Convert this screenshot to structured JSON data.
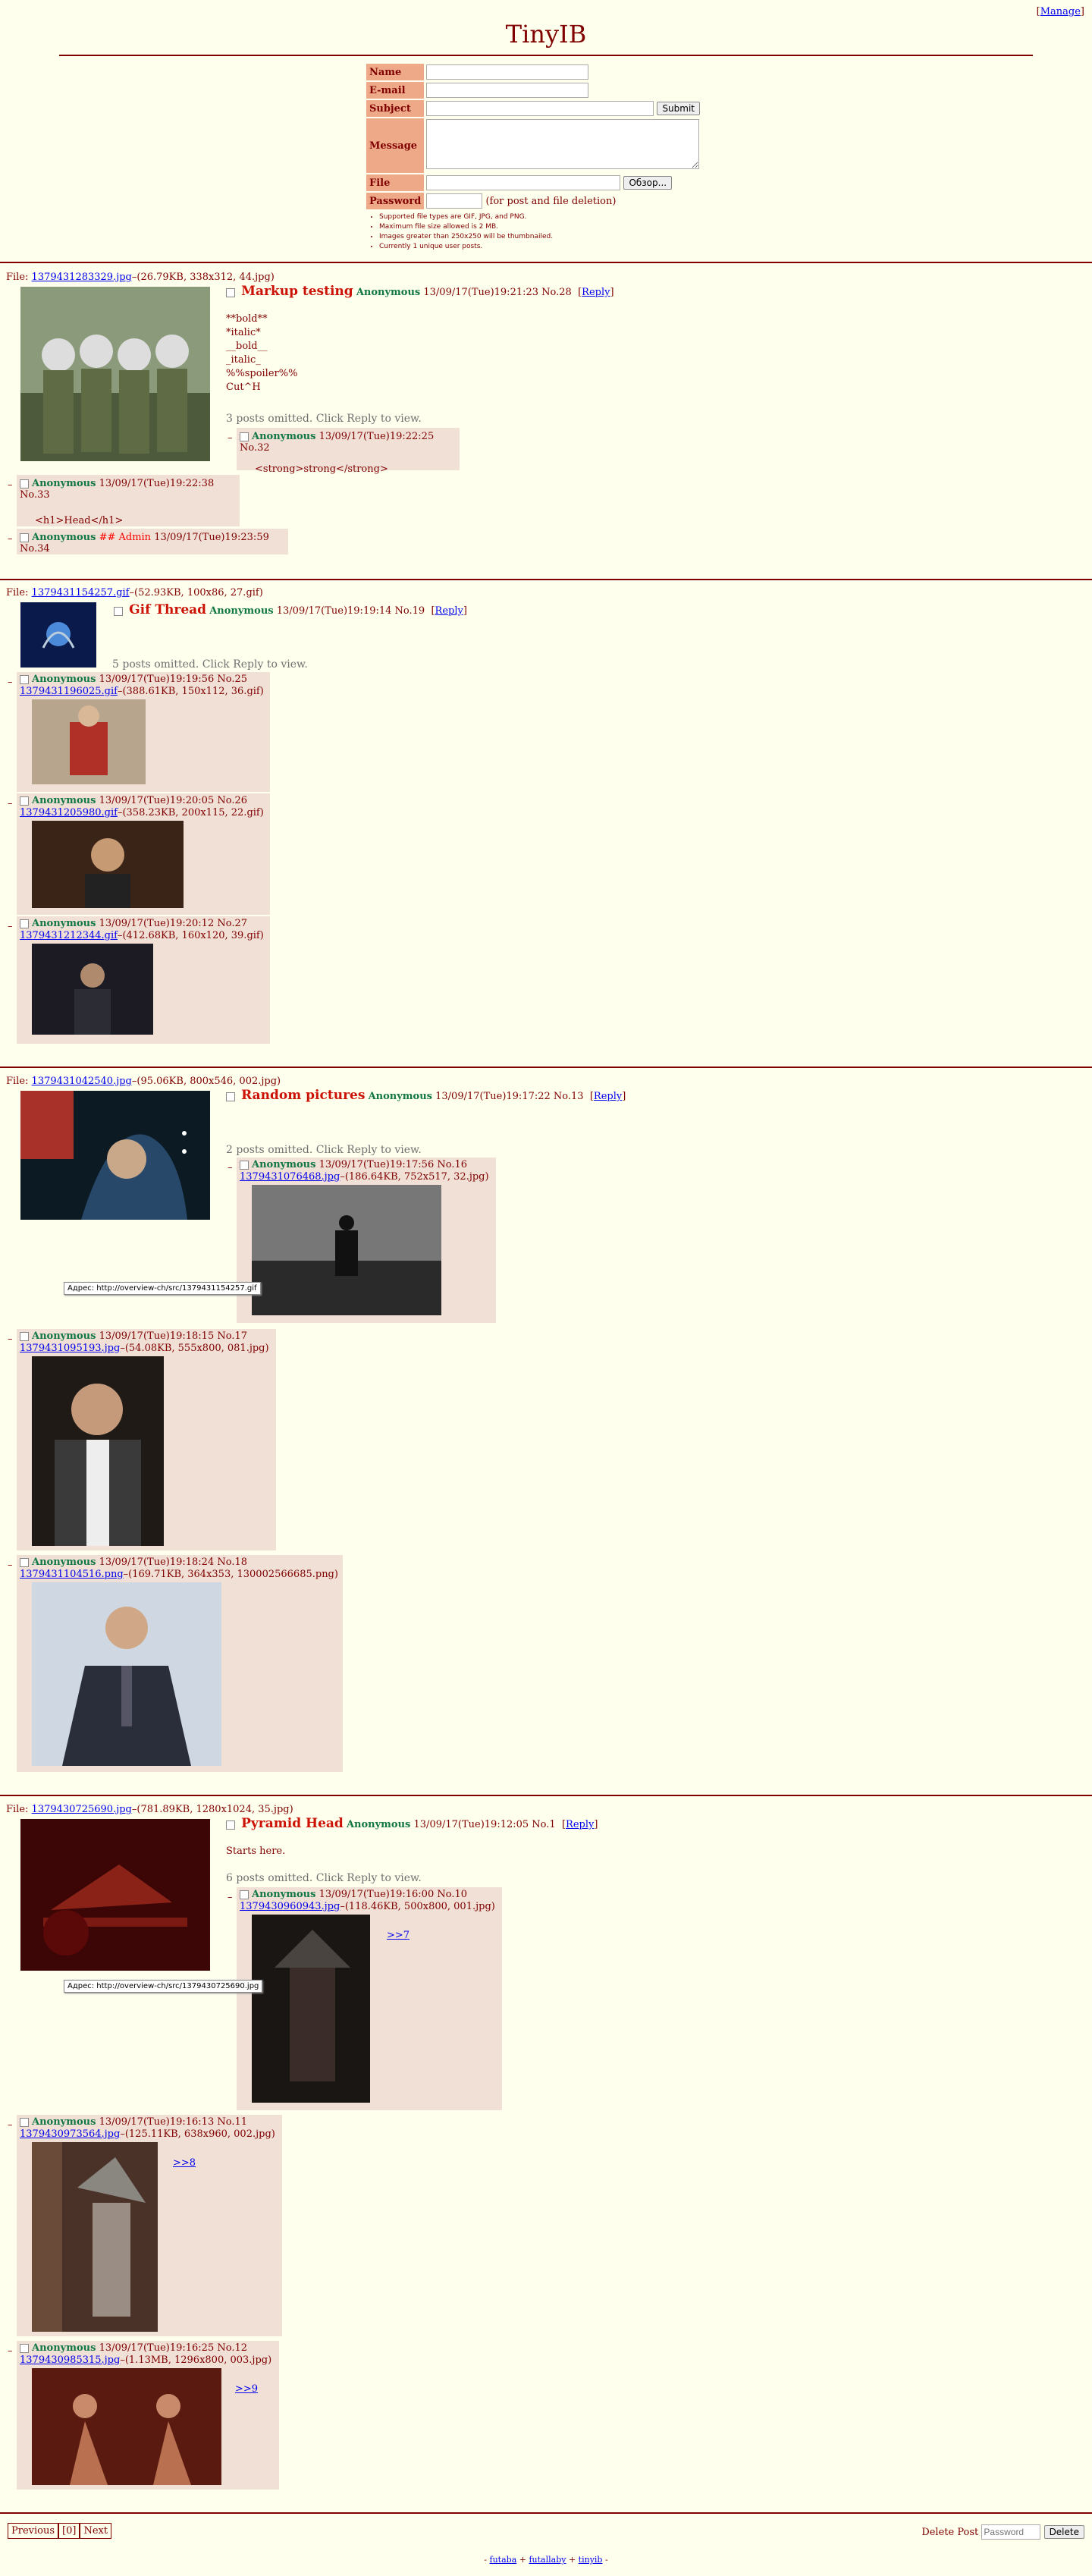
{
  "manage": "Manage",
  "title": "TinyIB",
  "form": {
    "name_label": "Name",
    "email_label": "E-mail",
    "subject_label": "Subject",
    "message_label": "Message",
    "file_label": "File",
    "password_label": "Password",
    "submit": "Submit",
    "browse": "Обзор...",
    "password_note": "(for post and file deletion)",
    "rules": [
      "Supported file types are GIF, JPG, and PNG.",
      "Maximum file size allowed is 2 MB.",
      "Images greater than 250x250 will be thumbnailed.",
      "Currently 1 unique user posts."
    ]
  },
  "threads": {
    "t1": {
      "file_prefix": "File: ",
      "file_link": "1379431283329.jpg",
      "file_meta": "–(26.79KB, 338x312, 44.jpg)",
      "subject": "Markup testing",
      "name": "Anonymous",
      "date": "13/09/17(Tue)19:21:23 No.28",
      "reply_link": "Reply",
      "message": [
        "**bold**",
        "*italic*",
        "__bold__",
        "_italic_",
        "%%spoiler%%",
        "Cut^H"
      ],
      "omitted": "3 posts omitted. Click Reply to view.",
      "r1": {
        "name": "Anonymous",
        "date": "13/09/17(Tue)19:22:25 No.32",
        "msg": "<strong>strong</strong>"
      },
      "r2": {
        "name": "Anonymous",
        "date": "13/09/17(Tue)19:22:38 No.33",
        "msg": "<h1>Head</h1>"
      },
      "r3": {
        "name": "Anonymous",
        "admin": "## Admin",
        "date": "13/09/17(Tue)19:23:59 No.34"
      }
    },
    "t2": {
      "file_prefix": "File: ",
      "file_link": "1379431154257.gif",
      "file_meta": "–(52.93KB, 100x86, 27.gif)",
      "subject": "Gif Thread",
      "name": "Anonymous",
      "date": "13/09/17(Tue)19:19:14 No.19",
      "reply_link": "Reply",
      "omitted": "5 posts omitted. Click Reply to view.",
      "r1": {
        "name": "Anonymous",
        "date": "13/09/17(Tue)19:19:56 No.25",
        "file_link": "1379431196025.gif",
        "file_meta": "–(388.61KB, 150x112, 36.gif)"
      },
      "r2": {
        "name": "Anonymous",
        "date": "13/09/17(Tue)19:20:05 No.26",
        "file_link": "1379431205980.gif",
        "file_meta": "–(358.23KB, 200x115, 22.gif)"
      },
      "r3": {
        "name": "Anonymous",
        "date": "13/09/17(Tue)19:20:12 No.27",
        "file_link": "1379431212344.gif",
        "file_meta": "–(412.68KB, 160x120, 39.gif)"
      }
    },
    "t3": {
      "file_prefix": "File: ",
      "file_link": "1379431042540.jpg",
      "file_meta": "–(95.06KB, 800x546, 002.jpg)",
      "subject": "Random pictures",
      "name": "Anonymous",
      "date": "13/09/17(Tue)19:17:22 No.13",
      "reply_link": "Reply",
      "omitted": "2 posts omitted. Click Reply to view.",
      "tooltip": "Адрес: http://overview-ch/src/1379431154257.gif",
      "r1": {
        "name": "Anonymous",
        "date": "13/09/17(Tue)19:17:56 No.16",
        "file_link": "1379431076468.jpg",
        "file_meta": "–(186.64KB, 752x517, 32.jpg)"
      },
      "r2": {
        "name": "Anonymous",
        "date": "13/09/17(Tue)19:18:15 No.17",
        "file_link": "1379431095193.jpg",
        "file_meta": "–(54.08KB, 555x800, 081.jpg)"
      },
      "r3": {
        "name": "Anonymous",
        "date": "13/09/17(Tue)19:18:24 No.18",
        "file_link": "1379431104516.png",
        "file_meta": "–(169.71KB, 364x353, 130002566685.png)"
      }
    },
    "t4": {
      "file_prefix": "File: ",
      "file_link": "1379430725690.jpg",
      "file_meta": "–(781.89KB, 1280x1024, 35.jpg)",
      "subject": "Pyramid Head",
      "name": "Anonymous",
      "date": "13/09/17(Tue)19:12:05 No.1",
      "reply_link": "Reply",
      "message": "Starts here.",
      "omitted": "6 posts omitted. Click Reply to view.",
      "tooltip": "Адрес: http://overview-ch/src/1379430725690.jpg",
      "r1": {
        "name": "Anonymous",
        "date": "13/09/17(Tue)19:16:00 No.10",
        "file_link": "1379430960943.jpg",
        "file_meta": "–(118.46KB, 500x800, 001.jpg)",
        "quote": ">>7"
      },
      "r2": {
        "name": "Anonymous",
        "date": "13/09/17(Tue)19:16:13 No.11",
        "file_link": "1379430973564.jpg",
        "file_meta": "–(125.11KB, 638x960, 002.jpg)",
        "quote": ">>8"
      },
      "r3": {
        "name": "Anonymous",
        "date": "13/09/17(Tue)19:16:25 No.12",
        "file_link": "1379430985315.jpg",
        "file_meta": "–(1.13MB, 1296x800, 003.jpg)",
        "quote": ">>9"
      }
    }
  },
  "pager": {
    "prev": "Previous",
    "current": "[0]",
    "next": "Next"
  },
  "delete": {
    "label": "Delete Post",
    "placeholder": "Password",
    "button": "Delete"
  },
  "footer": {
    "sep1": "- ",
    "link1": "futaba",
    "sep2": " + ",
    "link2": "futallaby",
    "sep3": " + ",
    "link3": "tinyib",
    "sep4": " -"
  }
}
